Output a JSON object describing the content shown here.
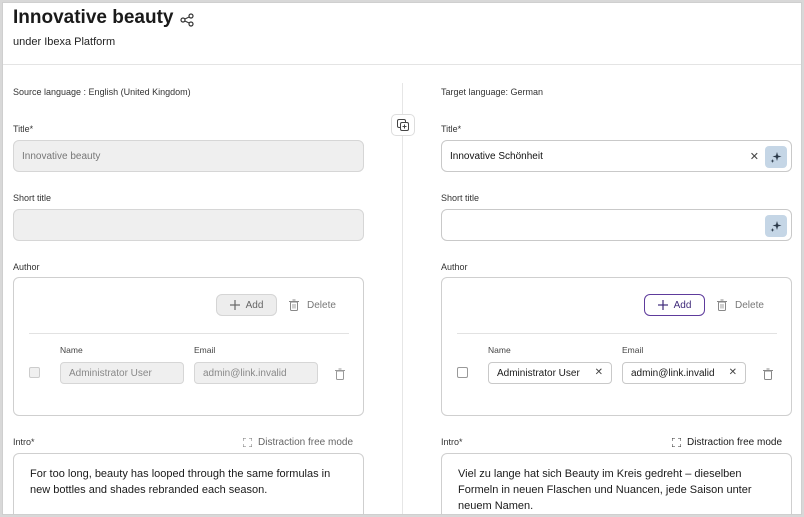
{
  "header": {
    "title": "Innovative beauty",
    "subtitle": "under Ibexa Platform"
  },
  "source": {
    "language_label": "Source language : English (United Kingdom)",
    "title_label": "Title*",
    "title_value": "Innovative beauty",
    "short_title_label": "Short title",
    "short_title_value": "",
    "author_label": "Author",
    "add_label": "Add",
    "delete_label": "Delete",
    "name_header": "Name",
    "email_header": "Email",
    "author_name": "Administrator User",
    "author_email": "admin@link.invalid",
    "intro_label": "Intro*",
    "distraction_label": "Distraction free mode",
    "intro_text": "For too long, beauty has looped through the same formulas in new bottles and shades rebranded each season."
  },
  "target": {
    "language_label": "Target language: German",
    "title_label": "Title*",
    "title_value": "Innovative Schönheit",
    "short_title_label": "Short title",
    "short_title_value": "",
    "author_label": "Author",
    "add_label": "Add",
    "delete_label": "Delete",
    "name_header": "Name",
    "email_header": "Email",
    "author_name": "Administrator User",
    "author_email": "admin@link.invalid",
    "intro_label": "Intro*",
    "distraction_label": "Distraction free mode",
    "intro_text": "Viel zu lange hat sich Beauty im Kreis gedreht – dieselben Formeln in neuen Flaschen und Nuancen, jede Saison unter neuem Namen."
  },
  "icons": {
    "share": "share-icon",
    "copy": "copy-icon",
    "ai": "ai-sparkle-icon",
    "clear": "close-icon",
    "plus": "plus-icon",
    "trash": "trash-icon",
    "expand": "expand-icon"
  },
  "colors": {
    "accent": "#5e3b9c",
    "ai_button": "#c5d6e6",
    "disabled_bg": "#efefef"
  }
}
